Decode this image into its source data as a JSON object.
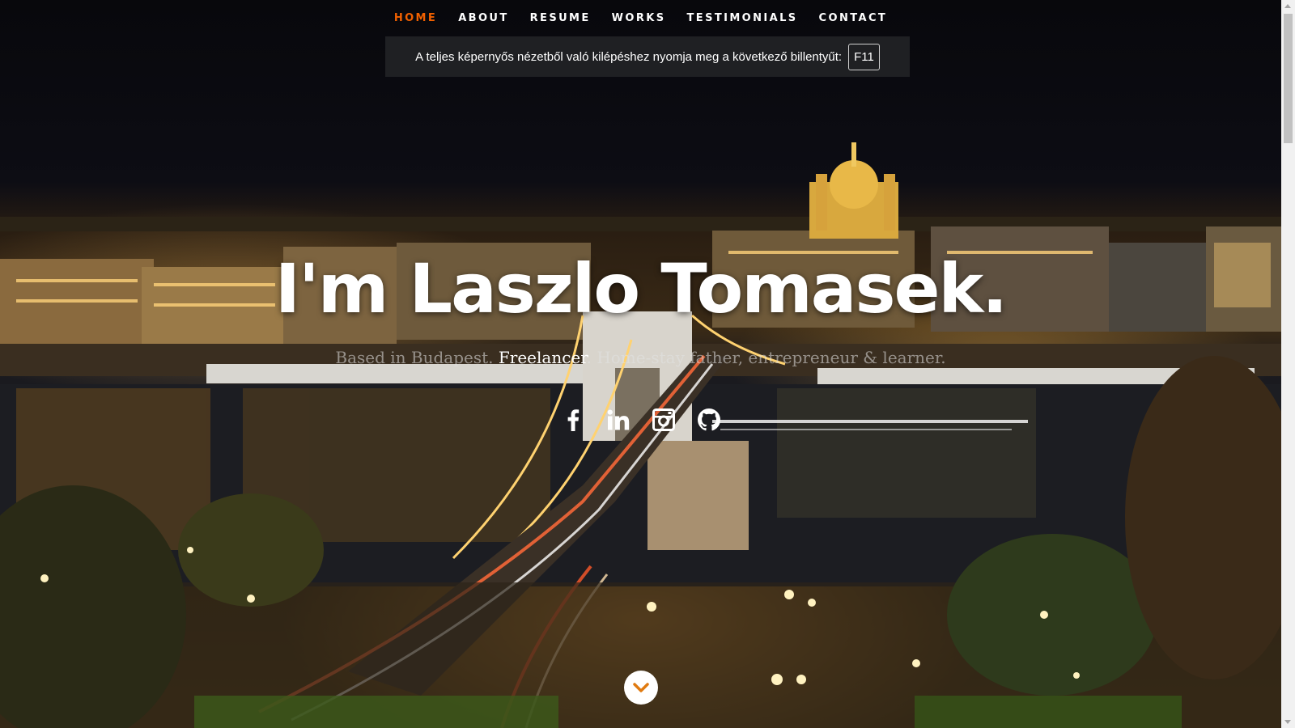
{
  "nav": {
    "items": [
      {
        "label": "HOME",
        "active": true
      },
      {
        "label": "ABOUT",
        "active": false
      },
      {
        "label": "RESUME",
        "active": false
      },
      {
        "label": "WORKS",
        "active": false
      },
      {
        "label": "TESTIMONIALS",
        "active": false
      },
      {
        "label": "CONTACT",
        "active": false
      }
    ],
    "active_color": "#f06000"
  },
  "fullscreen_notice": {
    "text": "A teljes képernyős nézetből való kilépéshez nyomja meg a következő billentyűt:",
    "key": "F11"
  },
  "hero": {
    "title": "I'm Laszlo Tomasek.",
    "subtitle_before": "Based in Budapest. ",
    "subtitle_highlight": "Freelancer",
    "subtitle_after": ". Home-stay father, entrepreneur & learner."
  },
  "social": [
    {
      "icon": "facebook-icon"
    },
    {
      "icon": "linkedin-icon"
    },
    {
      "icon": "instagram-icon"
    },
    {
      "icon": "github-icon"
    }
  ],
  "scroll_down": {
    "icon": "chevron-down-icon"
  }
}
